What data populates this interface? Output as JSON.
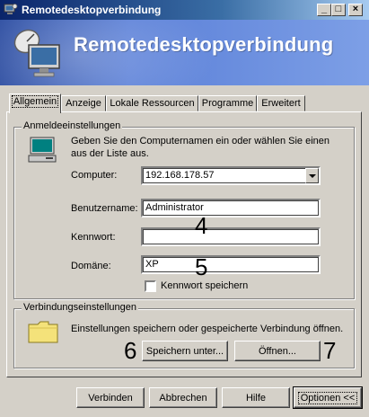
{
  "window": {
    "title": "Remotedesktopverbindung",
    "controls": {
      "minimize": "_",
      "maximize": "□",
      "close": "×"
    }
  },
  "banner": {
    "title": "Remotedesktopverbindung"
  },
  "tabs": [
    {
      "label": "Allgemein",
      "active": true
    },
    {
      "label": "Anzeige",
      "active": false
    },
    {
      "label": "Lokale Ressourcen",
      "active": false
    },
    {
      "label": "Programme",
      "active": false
    },
    {
      "label": "Erweitert",
      "active": false
    }
  ],
  "login": {
    "group_label": "Anmeldeeinstellungen",
    "description": "Geben Sie den Computernamen ein oder wählen Sie einen aus der Liste aus.",
    "computer_label": "Computer:",
    "computer_value": "192.168.178.57",
    "username_label": "Benutzername:",
    "username_value": "Administrator",
    "password_label": "Kennwort:",
    "password_value": "",
    "domain_label": "Domäne:",
    "domain_value": "XP",
    "save_password_label": "Kennwort speichern",
    "save_password_checked": false
  },
  "connection": {
    "group_label": "Verbindungseinstellungen",
    "description": "Einstellungen speichern oder gespeicherte Verbindung öffnen.",
    "save_as_label": "Speichern unter...",
    "open_label": "Öffnen..."
  },
  "annotations": {
    "n4": "4",
    "n5": "5",
    "n6": "6",
    "n7": "7"
  },
  "footer": {
    "connect_label": "Verbinden",
    "cancel_label": "Abbrechen",
    "help_label": "Hilfe",
    "options_label": "Optionen <<"
  },
  "icons": {
    "title": "rdp-computer-icon",
    "banner": "rdp-satellite-computer-icon",
    "computer": "computer-monitor-icon",
    "folder": "folder-icon"
  }
}
